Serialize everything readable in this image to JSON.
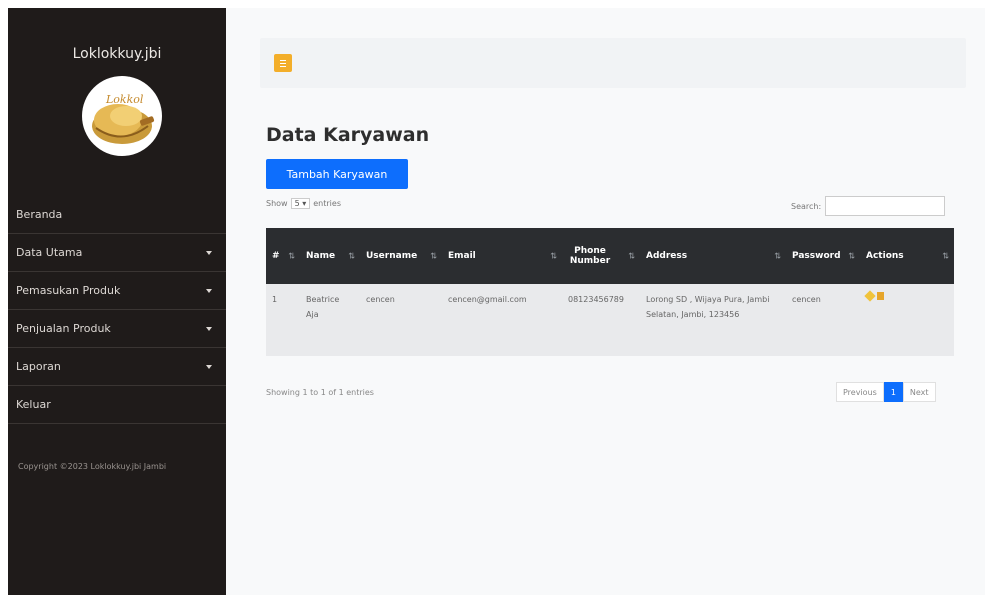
{
  "sidebar": {
    "brand": "Loklokkuy.jbi",
    "logo_text": "Lokkol",
    "items": [
      {
        "label": "Beranda",
        "has_caret": false
      },
      {
        "label": "Data Utama",
        "has_caret": true
      },
      {
        "label": "Pemasukan Produk",
        "has_caret": true
      },
      {
        "label": "Penjualan Produk",
        "has_caret": true
      },
      {
        "label": "Laporan",
        "has_caret": true
      },
      {
        "label": "Keluar",
        "has_caret": false
      }
    ],
    "copyright": "Copyright ©2023 Loklokkuy.jbi Jambi"
  },
  "main": {
    "title": "Data Karyawan",
    "add_button": "Tambah Karyawan",
    "show_label": "Show",
    "show_value": "5",
    "entries_label": "entries",
    "search_label": "Search:",
    "table": {
      "headers": [
        "#",
        "Name",
        "Username",
        "Email",
        "Phone Number",
        "Address",
        "Password",
        "Actions"
      ],
      "rows": [
        [
          "1",
          "Beatrice Aja",
          "cencen",
          "cencen@gmail.com",
          "08123456789",
          "Lorong SD , Wijaya Pura, Jambi Selatan, Jambi, 123456",
          "cencen"
        ]
      ]
    },
    "info": "Showing 1 to 1 of 1 entries",
    "pagination": {
      "previous": "Previous",
      "current": "1",
      "next": "Next"
    }
  },
  "colors": {
    "sidebar_bg": "#1f1b1a",
    "accent_blue": "#0d6efd",
    "toggle_yellow": "#f3ae2a",
    "table_header": "#2b2d30"
  }
}
